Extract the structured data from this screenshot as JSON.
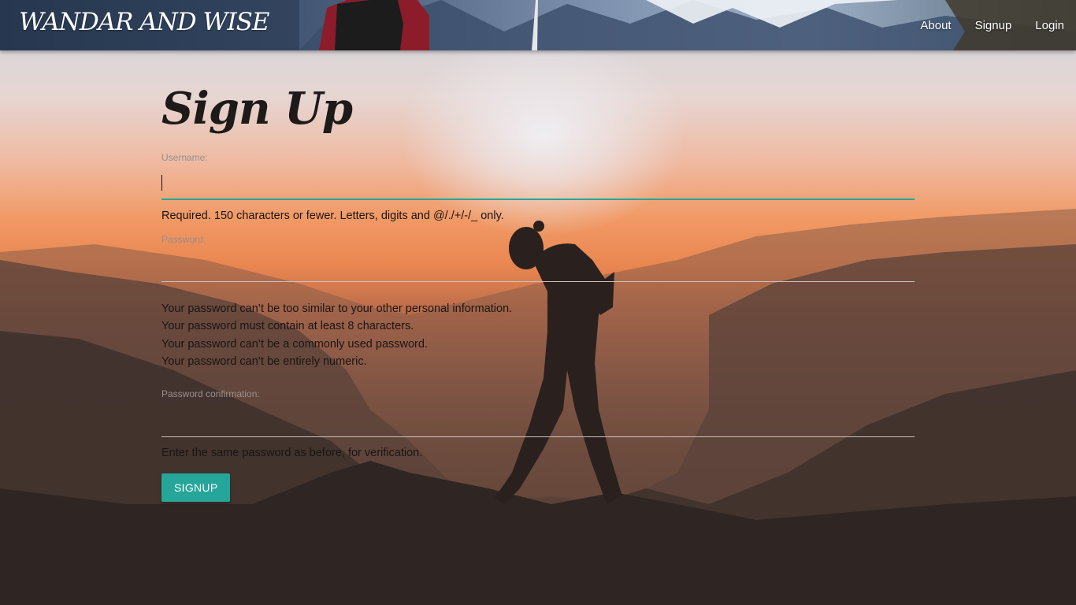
{
  "nav": {
    "brand": "WANDAR AND WISE",
    "links": [
      "About",
      "Signup",
      "Login"
    ]
  },
  "form": {
    "title": "Sign Up",
    "username": {
      "label": "Username:",
      "value": "",
      "help": "Required. 150 characters or fewer. Letters, digits and @/./+/-/_ only."
    },
    "password": {
      "label": "Password:",
      "value": "",
      "help": [
        "Your password can’t be too similar to your other personal information.",
        "Your password must contain at least 8 characters.",
        "Your password can’t be a commonly used password.",
        "Your password can’t be entirely numeric."
      ]
    },
    "password_confirmation": {
      "label": "Password confirmation:",
      "value": "",
      "help": "Enter the same password as before, for verification."
    },
    "submit_label": "SIGNUP"
  },
  "colors": {
    "accent": "#26a69a",
    "text": "#1a1514",
    "label": "#9a8e8c"
  }
}
